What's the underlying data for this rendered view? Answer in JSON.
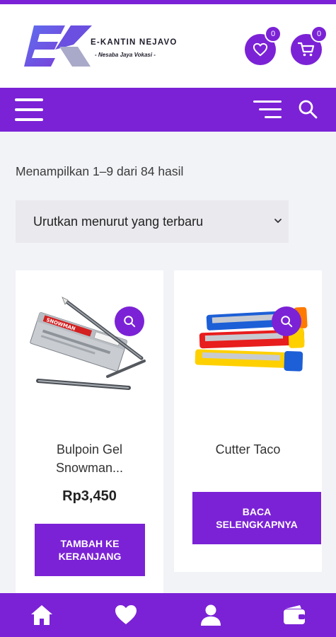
{
  "header": {
    "brand_name": "E-KANTIN NEJAVO",
    "brand_tagline": "- Nesaba Jaya Vokasi -",
    "wishlist_count": "0",
    "cart_count": "0"
  },
  "shop": {
    "results_text": "Menampilkan 1–9 dari 84 hasil",
    "sort_selected": "Urutkan menurut yang terbaru"
  },
  "products": [
    {
      "title_line1": "Bulpoin Gel",
      "title_line2": "Snowman...",
      "price": "Rp3,450",
      "cta_line1": "TAMBAH KE",
      "cta_line2": "KERANJANG"
    },
    {
      "title_line1": "Cutter Taco",
      "cta_line1": "BACA",
      "cta_line2": "SELENGKAPNYA"
    }
  ],
  "icons": {
    "wishlist": "heart-icon",
    "cart": "cart-icon",
    "menu": "hamburger-menu-icon",
    "categories": "list-menu-icon",
    "search": "search-icon",
    "quick_view": "search-icon",
    "bottom_nav": [
      "home-icon",
      "heart-icon",
      "user-icon",
      "wallet-icon"
    ]
  },
  "colors": {
    "accent": "#7b22d6",
    "background": "#f2f3f7",
    "card": "#ffffff"
  }
}
